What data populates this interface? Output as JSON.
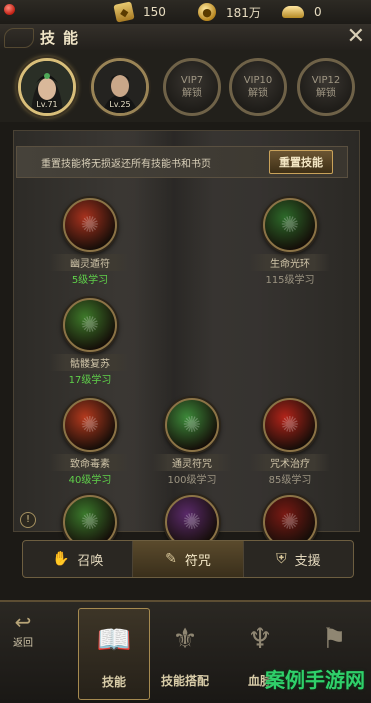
{
  "resources": [
    {
      "icon": "gem-card-icon",
      "value": "150"
    },
    {
      "icon": "gold-coin-icon",
      "value": "181万"
    },
    {
      "icon": "gold-ingot-icon",
      "value": "0"
    }
  ],
  "title": "技能",
  "heroes": [
    {
      "level": "Lv.71",
      "selected": true
    },
    {
      "level": "Lv.25",
      "selected": false
    }
  ],
  "locked_slots": [
    {
      "vip": "VIP7",
      "action": "解锁"
    },
    {
      "vip": "VIP10",
      "action": "解锁"
    },
    {
      "vip": "VIP12",
      "action": "解锁"
    }
  ],
  "notice": {
    "text": "重置技能将无损返还所有技能书和书页",
    "button": "重置技能"
  },
  "skills": [
    {
      "name": "幽灵遁符",
      "level": "5级学习",
      "learned": true,
      "color": "#a8321e"
    },
    {
      "name": "生命光环",
      "level": "115级学习",
      "learned": false,
      "color": "#2d6a2a"
    },
    {
      "name": "骷髅复苏",
      "level": "17级学习",
      "learned": true,
      "color": "#3e7a2a"
    },
    {
      "name": "致命毒素",
      "level": "40级学习",
      "learned": true,
      "color": "#b53a1e"
    },
    {
      "name": "通灵符咒",
      "level": "100级学习",
      "learned": false,
      "color": "#3d8a3a"
    },
    {
      "name": "咒术治疗",
      "level": "85级学习",
      "learned": false,
      "color": "#b3241a"
    },
    {
      "name": "",
      "level": "",
      "learned": false,
      "color": "#3b7a2c"
    },
    {
      "name": "",
      "level": "",
      "learned": false,
      "color": "#5a2a6a"
    },
    {
      "name": "",
      "level": "",
      "learned": false,
      "color": "#7a1a14"
    }
  ],
  "tabs": [
    {
      "label": "召唤",
      "icon": "hand-icon",
      "active": false
    },
    {
      "label": "符咒",
      "icon": "talisman-icon",
      "active": true
    },
    {
      "label": "支援",
      "icon": "shield-icon",
      "active": false
    }
  ],
  "back_label": "返回",
  "nav": [
    {
      "label": "技能",
      "active": true
    },
    {
      "label": "技能搭配",
      "active": false
    },
    {
      "label": "血脉",
      "active": false
    }
  ],
  "watermark": "案例手游网"
}
